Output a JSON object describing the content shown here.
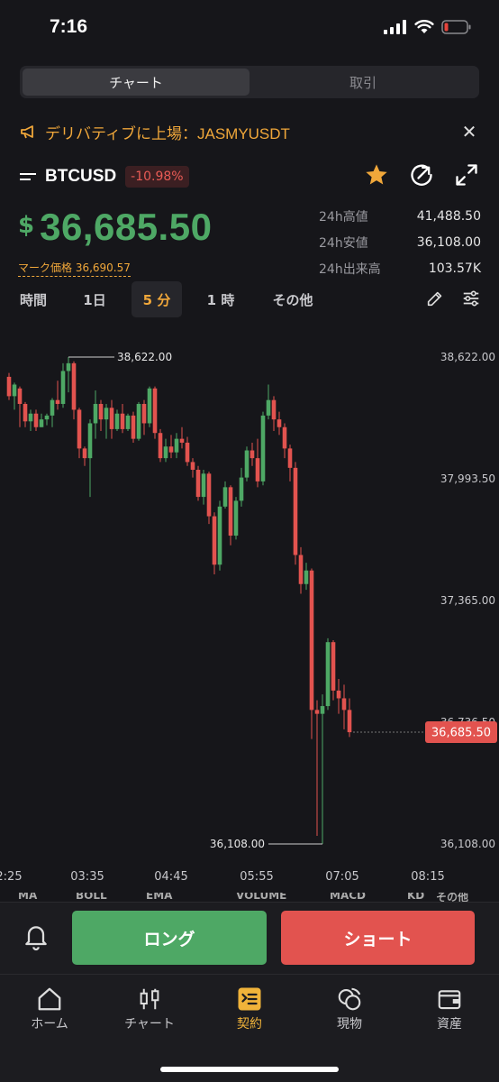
{
  "status": {
    "time": "7:16"
  },
  "segment": {
    "tabs": [
      "チャート",
      "取引"
    ],
    "active": 0
  },
  "banner": {
    "text": "デリバティブに上場：JASMYUSDT"
  },
  "pair": {
    "symbol": "BTCUSD",
    "change": "-10.98%",
    "favorite": true
  },
  "price": {
    "currency_symbol": "$",
    "value": "36,685.50",
    "mark_label": "マーク価格 36,690.57"
  },
  "stats": [
    {
      "label": "24h高値",
      "value": "41,488.50"
    },
    {
      "label": "24h安値",
      "value": "36,108.00"
    },
    {
      "label": "24h出来高",
      "value": "103.57K"
    }
  ],
  "timeframes": [
    "時間",
    "1日",
    "5 分",
    "1 時",
    "その他"
  ],
  "active_timeframe": "5 分",
  "chart_data": {
    "type": "candlestick",
    "y_axis_labels": [
      "38,622.00",
      "37,993.50",
      "37,365.00",
      "36,736.50",
      "36,108.00"
    ],
    "x_axis_labels": [
      "2:25",
      "03:35",
      "04:45",
      "05:55",
      "07:05",
      "08:15"
    ],
    "current_price_tag": "36,685.50",
    "high_marker": "38,622.00",
    "low_marker": "36,108.00",
    "up_color": "#4ea865",
    "down_color": "#e2534f",
    "candles": [
      [
        38520,
        38420,
        38540,
        38400
      ],
      [
        38420,
        38480,
        38490,
        38350
      ],
      [
        38460,
        38380,
        38470,
        38260
      ],
      [
        38380,
        38290,
        38390,
        38260
      ],
      [
        38290,
        38330,
        38350,
        38240
      ],
      [
        38330,
        38260,
        38350,
        38240
      ],
      [
        38260,
        38300,
        38330,
        38260
      ],
      [
        38300,
        38320,
        38330,
        38270
      ],
      [
        38320,
        38400,
        38410,
        38260
      ],
      [
        38400,
        38380,
        38500,
        38350
      ],
      [
        38380,
        38550,
        38590,
        38360
      ],
      [
        38550,
        38590,
        38622,
        38440
      ],
      [
        38590,
        38350,
        38600,
        38300
      ],
      [
        38350,
        38150,
        38360,
        38100
      ],
      [
        38150,
        38100,
        38160,
        38060
      ],
      [
        38100,
        38280,
        38300,
        37900
      ],
      [
        38280,
        38380,
        38450,
        38200
      ],
      [
        38380,
        38300,
        38400,
        38240
      ],
      [
        38300,
        38360,
        38380,
        38200
      ],
      [
        38360,
        38250,
        38400,
        38200
      ],
      [
        38250,
        38330,
        38350,
        38240
      ],
      [
        38330,
        38250,
        38380,
        38230
      ],
      [
        38250,
        38320,
        38330,
        38240
      ],
      [
        38320,
        38200,
        38340,
        38180
      ],
      [
        38200,
        38380,
        38390,
        38190
      ],
      [
        38380,
        38280,
        38400,
        38220
      ],
      [
        38280,
        38460,
        38470,
        38260
      ],
      [
        38460,
        38230,
        38470,
        38200
      ],
      [
        38230,
        38100,
        38250,
        38080
      ],
      [
        38100,
        38160,
        38200,
        38080
      ],
      [
        38160,
        38130,
        38220,
        38100
      ],
      [
        38130,
        38200,
        38230,
        38100
      ],
      [
        38200,
        38180,
        38260,
        38150
      ],
      [
        38180,
        38080,
        38210,
        38060
      ],
      [
        38080,
        38040,
        38100,
        38000
      ],
      [
        38040,
        37900,
        38060,
        37880
      ],
      [
        37900,
        38020,
        38040,
        37860
      ],
      [
        38020,
        37800,
        38030,
        37760
      ],
      [
        37800,
        37550,
        37820,
        37500
      ],
      [
        37550,
        37850,
        37880,
        37520
      ],
      [
        37850,
        37950,
        37980,
        37840
      ],
      [
        37950,
        37700,
        37960,
        37650
      ],
      [
        37700,
        37880,
        37900,
        37680
      ],
      [
        37880,
        38000,
        38050,
        37850
      ],
      [
        38000,
        38140,
        38160,
        37980
      ],
      [
        38140,
        38100,
        38180,
        38060
      ],
      [
        38100,
        37980,
        38200,
        37950
      ],
      [
        37980,
        38320,
        38340,
        37960
      ],
      [
        38320,
        38400,
        38480,
        38300
      ],
      [
        38400,
        38300,
        38420,
        38240
      ],
      [
        38300,
        38260,
        38340,
        38220
      ],
      [
        38260,
        38150,
        38280,
        38100
      ],
      [
        38150,
        38050,
        38170,
        37980
      ],
      [
        38050,
        37600,
        38080,
        37550
      ],
      [
        37600,
        37450,
        37640,
        37400
      ],
      [
        37450,
        37520,
        37560,
        37420
      ],
      [
        37520,
        36800,
        37530,
        36650
      ],
      [
        36800,
        36780,
        36850,
        36150
      ],
      [
        36780,
        36820,
        36880,
        36108
      ],
      [
        36820,
        37150,
        37170,
        36800
      ],
      [
        37150,
        36900,
        37160,
        36850
      ],
      [
        36900,
        36860,
        36960,
        36780
      ],
      [
        36860,
        36800,
        36930,
        36700
      ],
      [
        36800,
        36685,
        36860,
        36660
      ]
    ]
  },
  "indicator_tabs": [
    "MA",
    "BOLL",
    "EMA",
    "VOLUME",
    "MACD",
    "KD",
    "その他"
  ],
  "trade": {
    "long_label": "ロング",
    "short_label": "ショート"
  },
  "nav": [
    {
      "label": "ホーム",
      "icon": "home-icon"
    },
    {
      "label": "チャート",
      "icon": "candles-icon"
    },
    {
      "label": "契約",
      "icon": "contract-icon"
    },
    {
      "label": "現物",
      "icon": "spot-icon"
    },
    {
      "label": "資産",
      "icon": "wallet-icon"
    }
  ],
  "active_nav": "契約"
}
